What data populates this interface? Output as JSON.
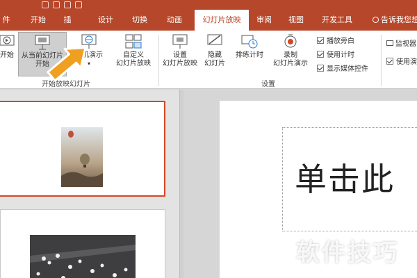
{
  "app": {
    "brand_color": "#b7472a",
    "active_tab_bg": "#ffffff"
  },
  "tabs": [
    {
      "label": "件",
      "active": false
    },
    {
      "label": "开始",
      "active": false
    },
    {
      "label": "插",
      "active": false
    },
    {
      "label": "设计",
      "active": false
    },
    {
      "label": "切换",
      "active": false
    },
    {
      "label": "动画",
      "active": false
    },
    {
      "label": "幻灯片放映",
      "active": true
    },
    {
      "label": "审阅",
      "active": false
    },
    {
      "label": "视图",
      "active": false
    },
    {
      "label": "开发工具",
      "active": false
    }
  ],
  "tell_me": "告诉我您想",
  "ribbon": {
    "from_start": "开始",
    "from_current_line1": "从当前幻灯片",
    "from_current_line2": "开始",
    "online_present": "联机演示",
    "custom_line1": "自定义",
    "custom_line2": "幻灯片放映",
    "group_start": "开始放映幻灯片",
    "setup_line1": "设置",
    "setup_line2": "幻灯片放映",
    "hide_line1": "隐藏",
    "hide_line2": "幻灯片",
    "rehearse": "排练计时",
    "record_line1": "录制",
    "record_line2": "幻灯片演示",
    "group_setup": "设置",
    "chk_narration": "播放旁白",
    "chk_timings": "使用计时",
    "chk_media": "显示媒体控件",
    "monitor": "监视器",
    "use_presenter": "使用演"
  },
  "checkboxes": {
    "narration": true,
    "timings": true,
    "media": true,
    "presenter": true
  },
  "slide": {
    "title_text": "单击此"
  },
  "watermark": "软件技巧"
}
